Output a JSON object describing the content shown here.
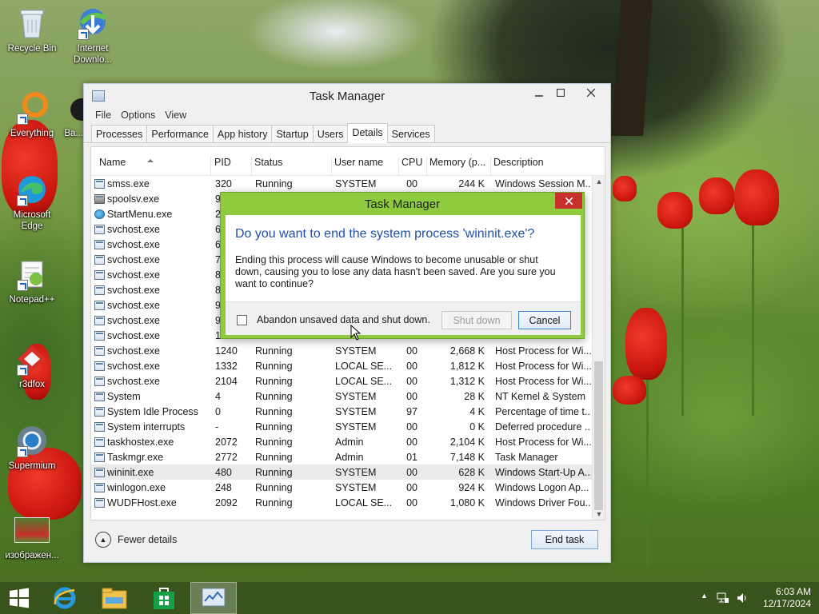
{
  "desktop": {
    "icons": [
      {
        "label": "Recycle Bin"
      },
      {
        "label": "Internet Downlo..."
      },
      {
        "label": "Everything"
      },
      {
        "label": "Ba..."
      },
      {
        "label": "Microsoft Edge"
      },
      {
        "label": "Notepad++"
      },
      {
        "label": "r3dfox"
      },
      {
        "label": "Supermium"
      },
      {
        "label": "изображен..."
      }
    ]
  },
  "task_manager": {
    "title": "Task Manager",
    "menu": [
      "File",
      "Options",
      "View"
    ],
    "tabs": [
      "Processes",
      "Performance",
      "App history",
      "Startup",
      "Users",
      "Details",
      "Services"
    ],
    "active_tab": "Details",
    "columns": {
      "name": "Name",
      "pid": "PID",
      "status": "Status",
      "user": "User name",
      "cpu": "CPU",
      "memory": "Memory (p...",
      "description": "Description"
    },
    "rows": [
      {
        "name": "smss.exe",
        "pid": "320",
        "status": "Running",
        "user": "SYSTEM",
        "cpu": "00",
        "mem": "244 K",
        "desc": "Windows Session M...",
        "icon": "window-icon"
      },
      {
        "name": "spoolsv.exe",
        "pid": "96",
        "status": "",
        "user": "",
        "cpu": "",
        "mem": "",
        "desc": "",
        "icon": "printer-icon"
      },
      {
        "name": "StartMenu.exe",
        "pid": "22",
        "status": "",
        "user": "",
        "cpu": "",
        "mem": "",
        "desc": "",
        "icon": "globe-icon"
      },
      {
        "name": "svchost.exe",
        "pid": "66",
        "status": "",
        "user": "",
        "cpu": "",
        "mem": "",
        "desc": "",
        "icon": "window-icon"
      },
      {
        "name": "svchost.exe",
        "pid": "69",
        "status": "",
        "user": "",
        "cpu": "",
        "mem": "",
        "desc": "",
        "icon": "window-icon"
      },
      {
        "name": "svchost.exe",
        "pid": "78",
        "status": "",
        "user": "",
        "cpu": "",
        "mem": "",
        "desc": "",
        "icon": "window-icon"
      },
      {
        "name": "svchost.exe",
        "pid": "81",
        "status": "",
        "user": "",
        "cpu": "",
        "mem": "",
        "desc": "",
        "icon": "window-icon"
      },
      {
        "name": "svchost.exe",
        "pid": "85",
        "status": "",
        "user": "",
        "cpu": "",
        "mem": "",
        "desc": "",
        "icon": "window-icon"
      },
      {
        "name": "svchost.exe",
        "pid": "90",
        "status": "",
        "user": "",
        "cpu": "",
        "mem": "",
        "desc": "",
        "icon": "window-icon"
      },
      {
        "name": "svchost.exe",
        "pid": "99",
        "status": "",
        "user": "",
        "cpu": "",
        "mem": "",
        "desc": "",
        "icon": "window-icon"
      },
      {
        "name": "svchost.exe",
        "pid": "10",
        "status": "",
        "user": "",
        "cpu": "",
        "mem": "",
        "desc": "",
        "icon": "window-icon"
      },
      {
        "name": "svchost.exe",
        "pid": "1240",
        "status": "Running",
        "user": "SYSTEM",
        "cpu": "00",
        "mem": "2,668 K",
        "desc": "Host Process for Wi...",
        "icon": "window-icon"
      },
      {
        "name": "svchost.exe",
        "pid": "1332",
        "status": "Running",
        "user": "LOCAL SE...",
        "cpu": "00",
        "mem": "1,812 K",
        "desc": "Host Process for Wi...",
        "icon": "window-icon"
      },
      {
        "name": "svchost.exe",
        "pid": "2104",
        "status": "Running",
        "user": "LOCAL SE...",
        "cpu": "00",
        "mem": "1,312 K",
        "desc": "Host Process for Wi...",
        "icon": "window-icon"
      },
      {
        "name": "System",
        "pid": "4",
        "status": "Running",
        "user": "SYSTEM",
        "cpu": "00",
        "mem": "28 K",
        "desc": "NT Kernel & System",
        "icon": "window-icon"
      },
      {
        "name": "System Idle Process",
        "pid": "0",
        "status": "Running",
        "user": "SYSTEM",
        "cpu": "97",
        "mem": "4 K",
        "desc": "Percentage of time t...",
        "icon": "window-icon"
      },
      {
        "name": "System interrupts",
        "pid": "-",
        "status": "Running",
        "user": "SYSTEM",
        "cpu": "00",
        "mem": "0 K",
        "desc": "Deferred procedure ...",
        "icon": "window-icon"
      },
      {
        "name": "taskhostex.exe",
        "pid": "2072",
        "status": "Running",
        "user": "Admin",
        "cpu": "00",
        "mem": "2,104 K",
        "desc": "Host Process for Wi...",
        "icon": "window-icon"
      },
      {
        "name": "Taskmgr.exe",
        "pid": "2772",
        "status": "Running",
        "user": "Admin",
        "cpu": "01",
        "mem": "7,148 K",
        "desc": "Task Manager",
        "icon": "taskmgr-icon"
      },
      {
        "name": "wininit.exe",
        "pid": "480",
        "status": "Running",
        "user": "SYSTEM",
        "cpu": "00",
        "mem": "628 K",
        "desc": "Windows Start-Up A...",
        "icon": "window-icon",
        "selected": true
      },
      {
        "name": "winlogon.exe",
        "pid": "248",
        "status": "Running",
        "user": "SYSTEM",
        "cpu": "00",
        "mem": "924 K",
        "desc": "Windows Logon Ap...",
        "icon": "window-icon"
      },
      {
        "name": "WUDFHost.exe",
        "pid": "2092",
        "status": "Running",
        "user": "LOCAL SE...",
        "cpu": "00",
        "mem": "1,080 K",
        "desc": "Windows Driver Fou...",
        "icon": "window-icon"
      }
    ],
    "footer": {
      "fewer_details": "Fewer details",
      "end_task": "End task"
    }
  },
  "dialog": {
    "title": "Task Manager",
    "question": "Do you want to end the system process 'wininit.exe'?",
    "message": "Ending this process will cause Windows to become unusable or shut down, causing you to lose any data hasn't been saved. Are you sure you want to continue?",
    "checkbox_label": "Abandon unsaved data and shut down.",
    "checkbox_checked": false,
    "shutdown_label": "Shut down",
    "cancel_label": "Cancel",
    "accent_color": "#8fcb3e"
  },
  "taskbar": {
    "apps": [
      "start-icon",
      "internet-explorer-icon",
      "file-explorer-icon",
      "store-icon",
      "task-manager-icon"
    ],
    "active_app": "task-manager-icon",
    "time": "6:03 AM",
    "date": "12/17/2024"
  }
}
